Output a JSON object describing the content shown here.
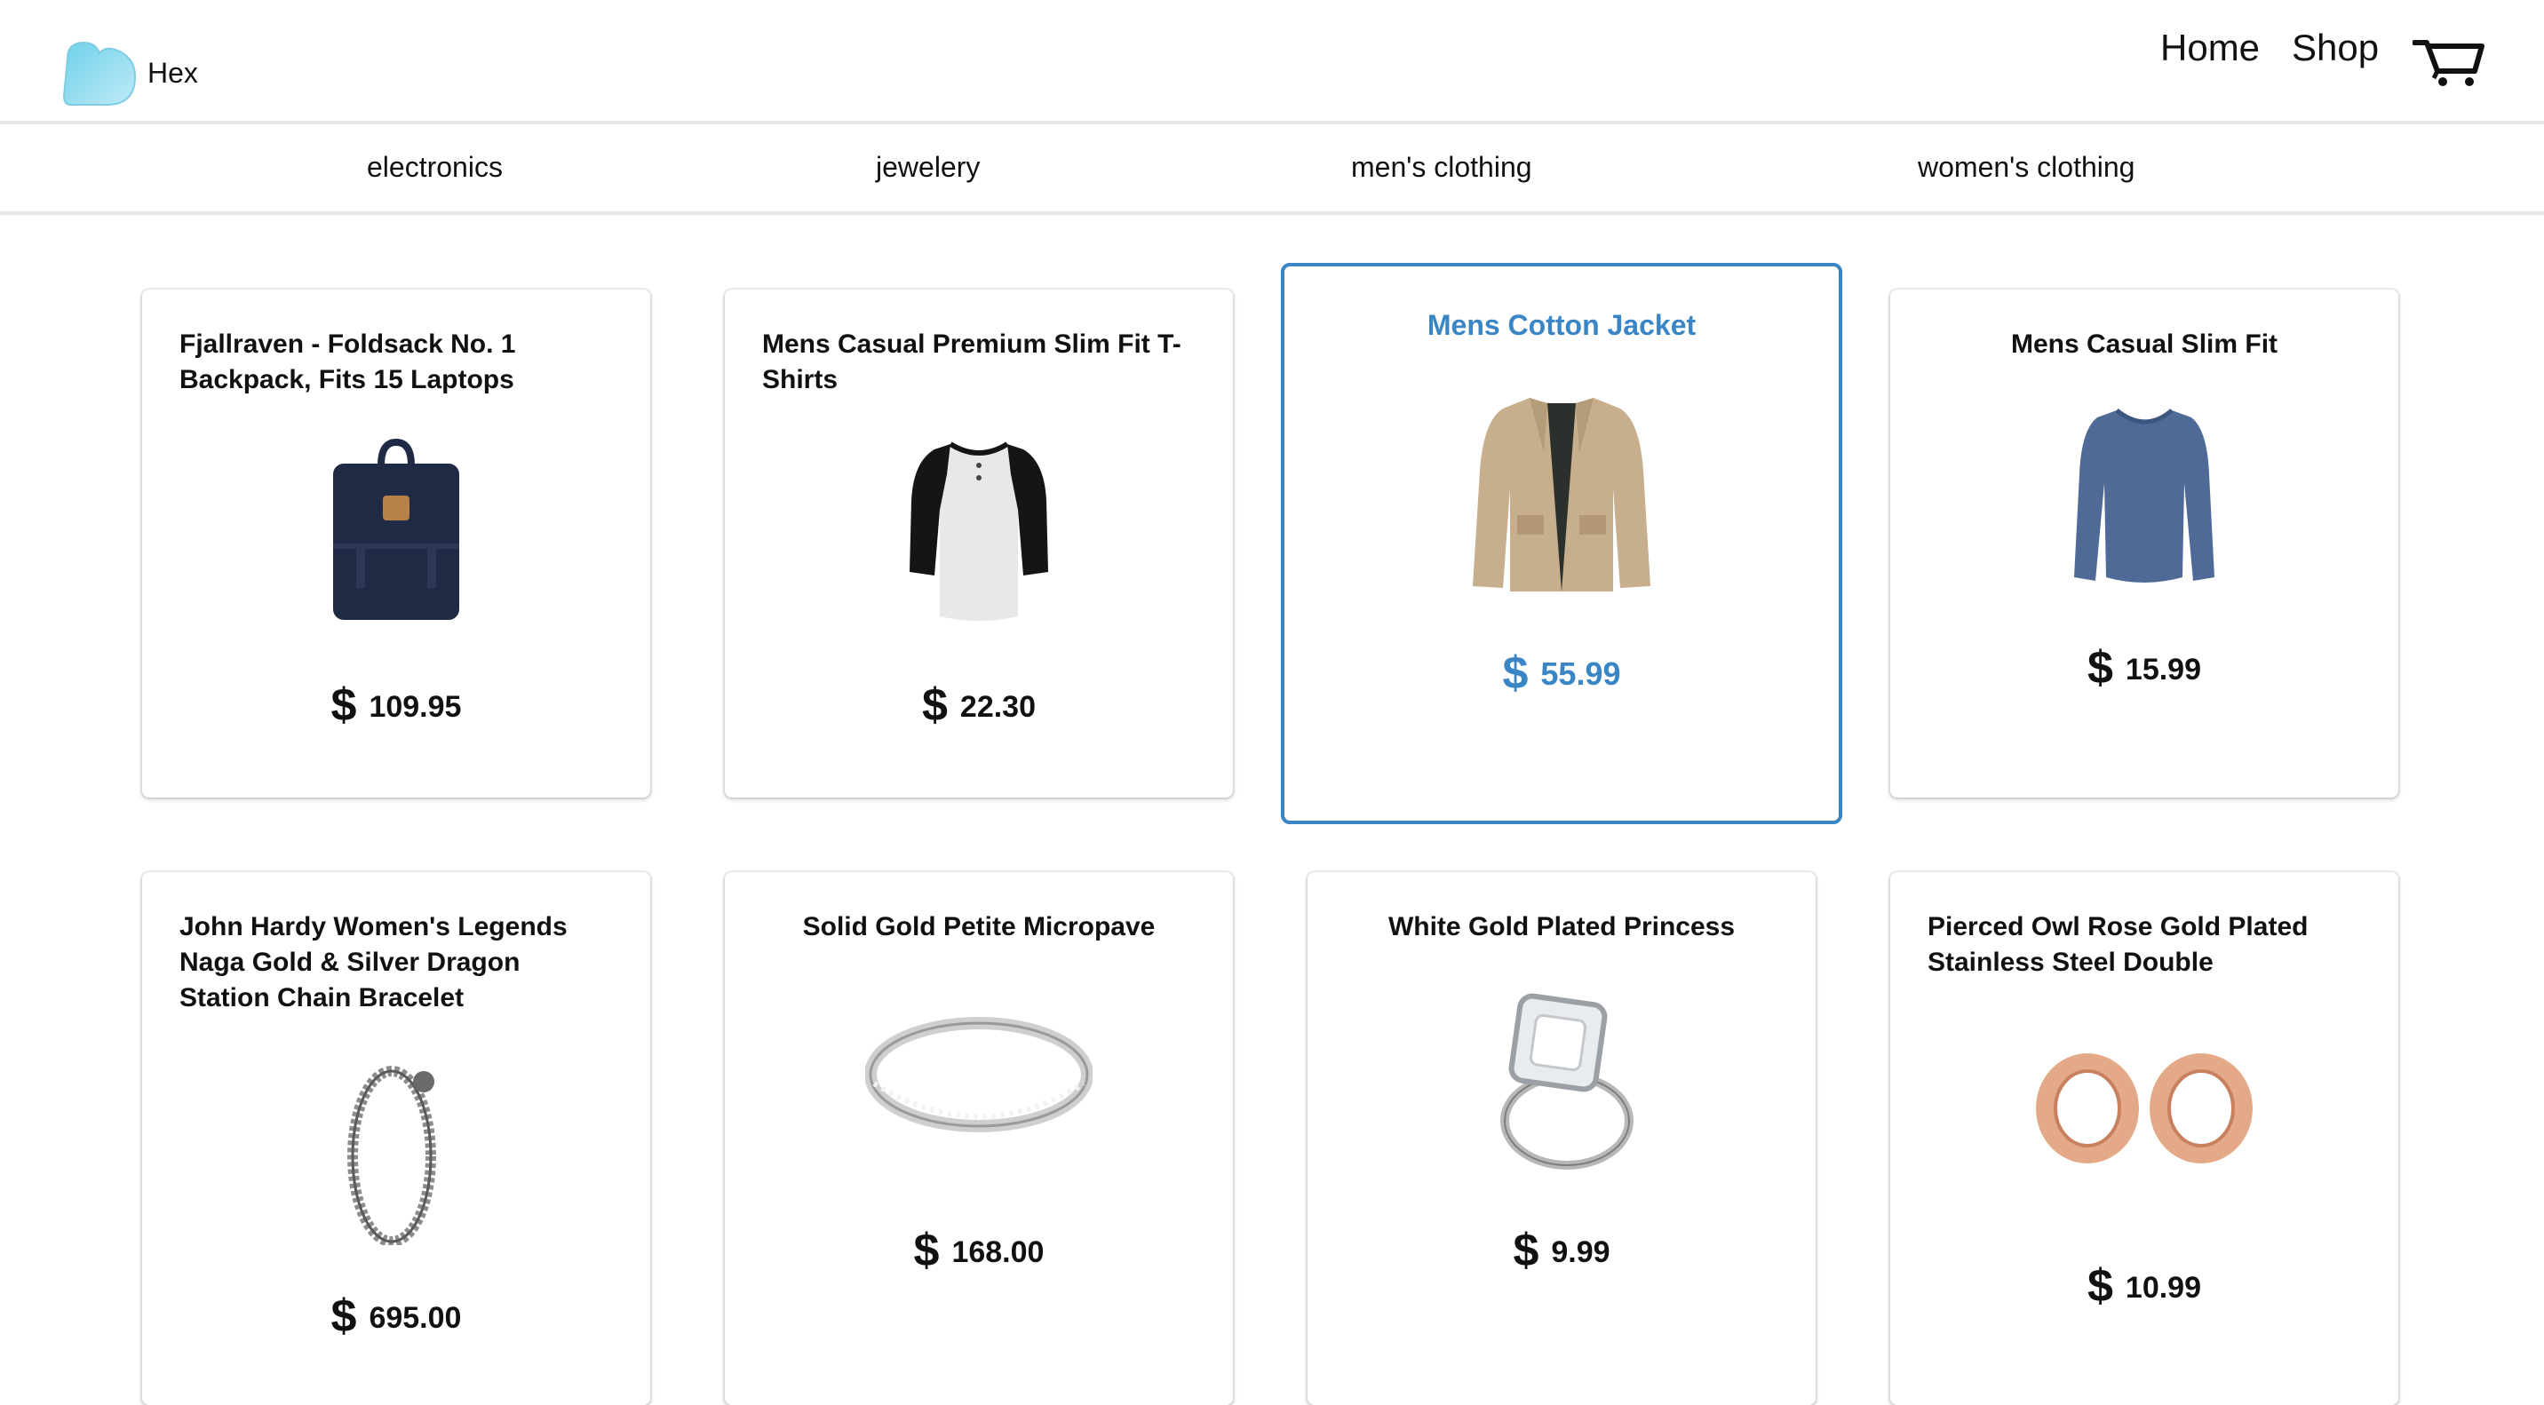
{
  "header": {
    "brand": "Hex",
    "nav": {
      "home": "Home",
      "shop": "Shop"
    }
  },
  "categories": [
    "electronics",
    "jewelery",
    "men's clothing",
    "women's clothing"
  ],
  "colors": {
    "accent": "#3a85c6",
    "text": "#111111",
    "divider": "#e6e6e6"
  },
  "currency": "$",
  "products": [
    {
      "title": "Fjallraven - Foldsack No. 1 Backpack, Fits 15 Laptops",
      "price": "109.95",
      "image": "backpack-image"
    },
    {
      "title": "Mens Casual Premium Slim Fit T-Shirts",
      "price": "22.30",
      "image": "tshirt-image"
    },
    {
      "title": "Mens Cotton Jacket",
      "price": "55.99",
      "image": "jacket-image",
      "hovered": true
    },
    {
      "title": "Mens Casual Slim Fit",
      "price": "15.99",
      "image": "longsleeve-image"
    },
    {
      "title": "John Hardy Women's Legends Naga Gold & Silver Dragon Station Chain Bracelet",
      "price": "695.00",
      "image": "bracelet-image"
    },
    {
      "title": "Solid Gold Petite Micropave",
      "price": "168.00",
      "image": "ring-image"
    },
    {
      "title": "White Gold Plated Princess",
      "price": "9.99",
      "image": "princess-ring-image"
    },
    {
      "title": "Pierced Owl Rose Gold Plated Stainless Steel Double",
      "price": "10.99",
      "image": "tunnel-plugs-image"
    }
  ]
}
